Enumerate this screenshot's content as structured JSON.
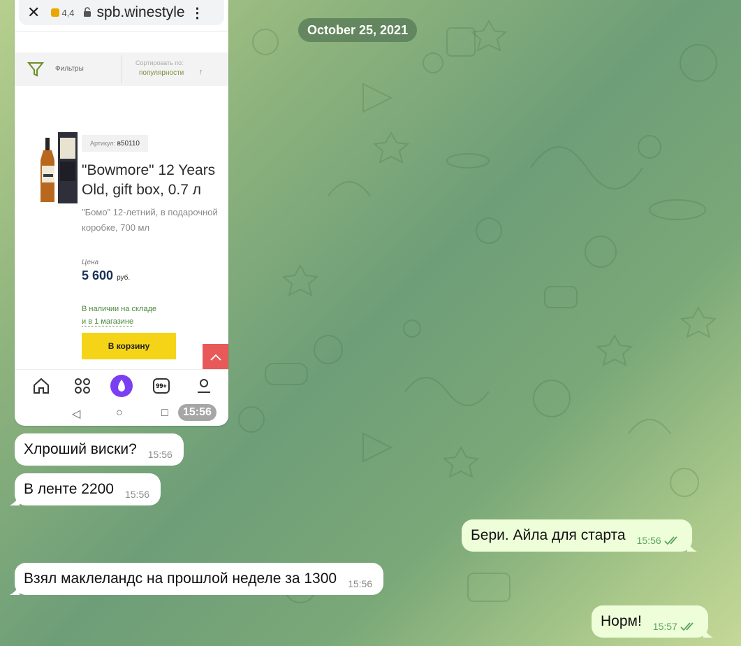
{
  "chat": {
    "date": "October 25, 2021",
    "messages": [
      {
        "text": "Хлроший виски?",
        "time": "15:56",
        "dir": "in"
      },
      {
        "text": "В ленте 2200",
        "time": "15:56",
        "dir": "in"
      },
      {
        "text": "Бери. Айла для старта",
        "time": "15:56",
        "dir": "out"
      },
      {
        "text": "Взял маклеландс на прошлой неделе за 1300",
        "time": "15:56",
        "dir": "in"
      },
      {
        "text": "Норм!",
        "time": "15:57",
        "dir": "out"
      }
    ],
    "image_time": "15:56"
  },
  "screenshot": {
    "browser": {
      "rating": "4,4",
      "url": "spb.winestyle",
      "close_glyph": "✕",
      "menu_glyph": "⋮"
    },
    "filters_label": "Фильтры",
    "sort_caption": "Сортировать по:",
    "sort_value": "популярности",
    "sort_arrow": "↑",
    "sku_label": "Артикул:",
    "sku_value": "в50110",
    "product_name": "\"Bowmore\" 12 Years Old, gift box, 0.7 л",
    "product_desc": "\"Бомо\" 12-летний, в подарочной коробке, 700 мл",
    "price_caption": "Цена",
    "price_value": "5 600",
    "price_currency": "руб.",
    "availability_line1": "В наличии на складе",
    "availability_line2": "и в 1 магазине",
    "cart_button": "В корзину",
    "tabs_badge": "99+"
  },
  "colors": {
    "incoming_bubble": "#ffffff",
    "outgoing_bubble": "#eefed9",
    "cart_button": "#f5d418",
    "scroll_up_button": "#e85a5a"
  }
}
